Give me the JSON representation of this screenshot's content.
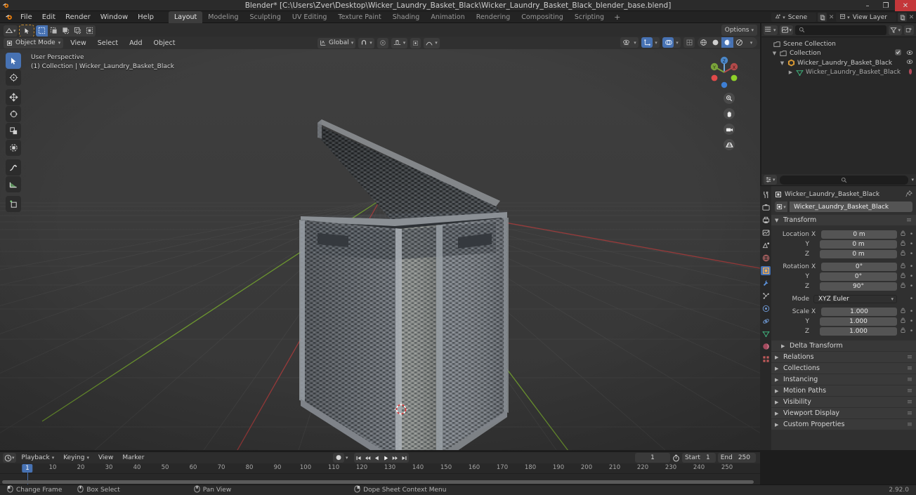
{
  "window": {
    "title": "Blender* [C:\\Users\\Zver\\Desktop\\Wicker_Laundry_Basket_Black\\Wicker_Laundry_Basket_Black_blender_base.blend]",
    "minimize": "–",
    "maximize": "❐",
    "close": "✕"
  },
  "topbar": {
    "menus": [
      "File",
      "Edit",
      "Render",
      "Window",
      "Help"
    ],
    "workspaces": [
      {
        "label": "Layout",
        "active": true
      },
      {
        "label": "Modeling",
        "active": false
      },
      {
        "label": "Sculpting",
        "active": false
      },
      {
        "label": "UV Editing",
        "active": false
      },
      {
        "label": "Texture Paint",
        "active": false
      },
      {
        "label": "Shading",
        "active": false
      },
      {
        "label": "Animation",
        "active": false
      },
      {
        "label": "Rendering",
        "active": false
      },
      {
        "label": "Compositing",
        "active": false
      },
      {
        "label": "Scripting",
        "active": false
      }
    ],
    "add_workspace": "+",
    "scene_name": "Scene",
    "view_layer_name": "View Layer"
  },
  "viewport_header": {
    "mode": "Object Mode",
    "menus": [
      "View",
      "Select",
      "Add",
      "Object"
    ],
    "transform_orientation": "Global",
    "options_label": "Options"
  },
  "viewport": {
    "perspective_label": "User Perspective",
    "collection_label": "(1) Collection | Wicker_Laundry_Basket_Black",
    "gizmo_axes": [
      "Z",
      "Y",
      "X"
    ],
    "background_color": "#3b3b3b"
  },
  "outliner": {
    "rows": [
      {
        "label": "Scene Collection",
        "depth": 0,
        "icon": "collection-icon",
        "arrow": "",
        "checkbox": false,
        "eye": false
      },
      {
        "label": "Collection",
        "depth": 1,
        "icon": "collection-icon",
        "arrow": "▼",
        "checkbox": true,
        "eye": true
      },
      {
        "label": "Wicker_Laundry_Basket_Black",
        "depth": 2,
        "icon": "object-icon",
        "arrow": "▼",
        "checkbox": false,
        "eye": true
      },
      {
        "label": "Wicker_Laundry_Basket_Black",
        "depth": 3,
        "icon": "mesh-icon",
        "arrow": "▶",
        "checkbox": false,
        "eye": false
      }
    ]
  },
  "properties": {
    "breadcrumb": "Wicker_Laundry_Basket_Black",
    "object_name": "Wicker_Laundry_Basket_Black",
    "transform_title": "Transform",
    "location": {
      "label": "Location",
      "x_label": "X",
      "y_label": "Y",
      "z_label": "Z",
      "x": "0 m",
      "y": "0 m",
      "z": "0 m"
    },
    "rotation": {
      "label": "Rotation",
      "x_label": "X",
      "y_label": "Y",
      "z_label": "Z",
      "x": "0°",
      "y": "0°",
      "z": "90°"
    },
    "mode": {
      "label": "Mode",
      "value": "XYZ Euler"
    },
    "scale": {
      "label": "Scale",
      "x_label": "X",
      "y_label": "Y",
      "z_label": "Z",
      "x": "1.000",
      "y": "1.000",
      "z": "1.000"
    },
    "panels": [
      "Delta Transform",
      "Relations",
      "Collections",
      "Instancing",
      "Motion Paths",
      "Visibility",
      "Viewport Display",
      "Custom Properties"
    ]
  },
  "timeline": {
    "menus": [
      "Playback",
      "Keying",
      "View",
      "Marker"
    ],
    "current_frame": "1",
    "start_label": "Start",
    "start_value": "1",
    "end_label": "End",
    "end_value": "250",
    "playhead_frame": "1",
    "ticks": [
      "10",
      "20",
      "30",
      "40",
      "50",
      "60",
      "70",
      "80",
      "90",
      "100",
      "110",
      "120",
      "130",
      "140",
      "150",
      "160",
      "170",
      "180",
      "190",
      "200",
      "210",
      "220",
      "230",
      "240",
      "250"
    ]
  },
  "statusbar": {
    "items": [
      {
        "mouse": "left",
        "label": "Change Frame"
      },
      {
        "mouse": "middle",
        "label": "Box Select"
      },
      {
        "mouse": "middle2",
        "label": "Pan View"
      },
      {
        "mouse": "right",
        "label": "Dope Sheet Context Menu"
      }
    ],
    "version": "2.92.0"
  },
  "colors": {
    "accent_blue": "#4772b3",
    "header_bg": "#2d2d2d",
    "panel_bg": "#303030",
    "viewport_bg": "#3b3b3b",
    "x_axis": "#a33b3b",
    "y_axis": "#6f9b2f"
  }
}
